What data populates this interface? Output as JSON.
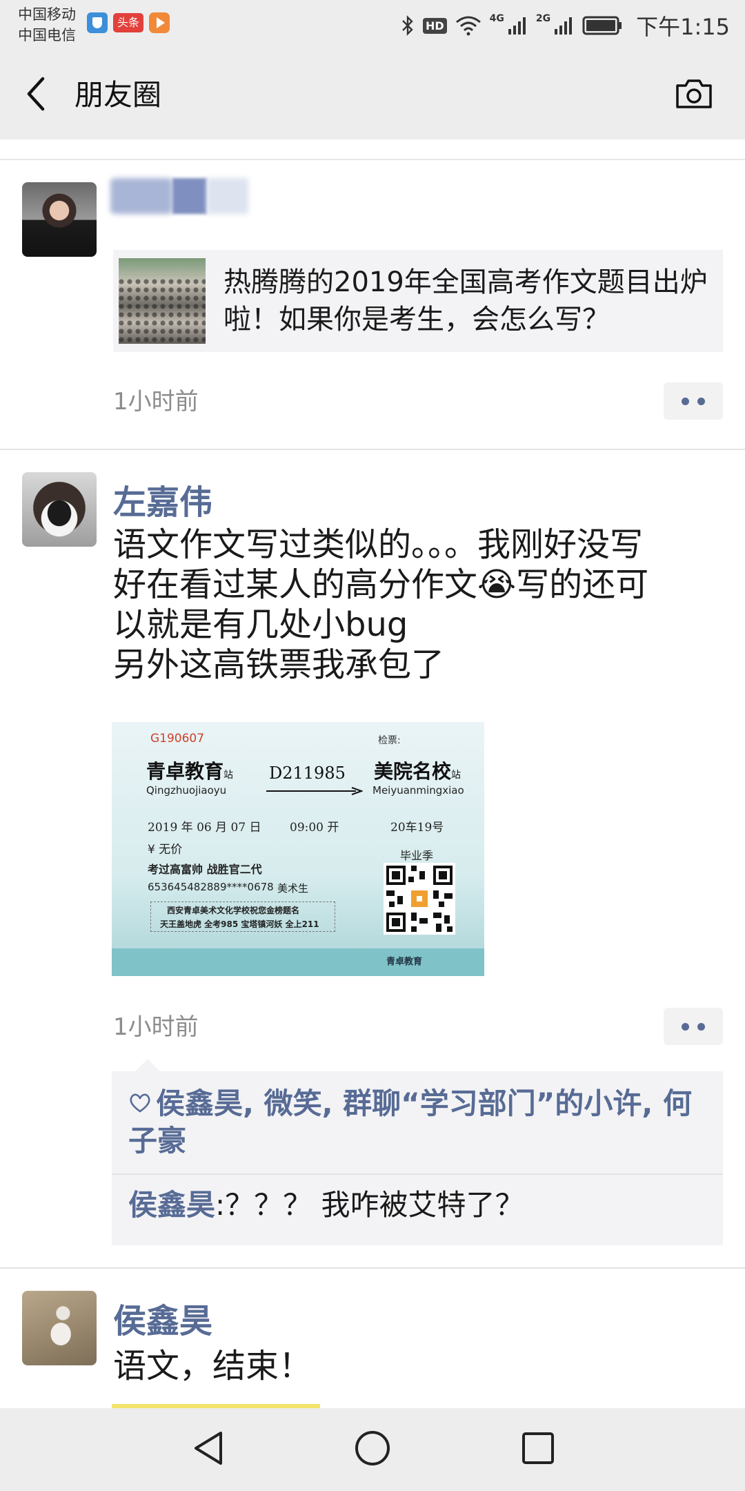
{
  "status_bar": {
    "carrier1": "中国移动",
    "carrier2": "中国电信",
    "toutiao_badge": "头条",
    "hd": "HD",
    "net1": "4G",
    "net2": "2G",
    "time": "下午1:15"
  },
  "nav": {
    "title": "朋友圈"
  },
  "post1": {
    "link_title": "热腾腾的2019年全国高考作文题目出炉啦！如果你是考生，会怎么写？",
    "time": "1小时前"
  },
  "post2": {
    "author": "左嘉伟",
    "text_line1": "语文作文写过类似的。。。我刚好没写",
    "text_line2a": "好在看过某人的高分作文",
    "text_line2b": "写的还可",
    "text_line3": "以就是有几处小bug",
    "text_line4": "另外这高铁票我承包了",
    "emoji": "😭",
    "time": "1小时前",
    "ticket": {
      "code": "G190607",
      "check": "检票:",
      "from": "青卓教育",
      "from_suffix": "站",
      "from_pinyin": "Qingzhuojiaoyu",
      "train": "D211985",
      "to": "美院名校",
      "to_suffix": "站",
      "to_pinyin": "Meiyuanmingxiao",
      "date": "2019 年 06 月 07 日",
      "departure": "09:00 开",
      "seat": "20车19号",
      "price": "¥ 无价",
      "season": "毕业季",
      "seat_type": "考过高富帅 战胜官二代",
      "id_no": "653645482889****0678",
      "class": "美术生",
      "slogan1": "西安青卓美术文化学校祝您金榜题名",
      "slogan2": "天王盖地虎 全考985 宝塔镇河妖 全上211",
      "brand": "青卓教育"
    },
    "likes": "侯鑫昊, 微笑, 群聊“学习部门”的小许, 何子豪",
    "comment_author": "侯鑫昊",
    "comment_text": ":？？？ 我咋被艾特了？"
  },
  "post3": {
    "author": "侯鑫昊",
    "text": "语文，结束！"
  },
  "colors": {
    "link_blue": "#576b95",
    "bar_bg": "#ededed",
    "timestamp": "#8c8c8c"
  },
  "icons": [
    "back-chevron-icon",
    "camera-icon",
    "heart-icon",
    "more-dots-icon",
    "bluetooth-icon",
    "wifi-icon",
    "signal-icon",
    "battery-icon",
    "nav-back-icon",
    "nav-home-icon",
    "nav-recents-icon"
  ]
}
